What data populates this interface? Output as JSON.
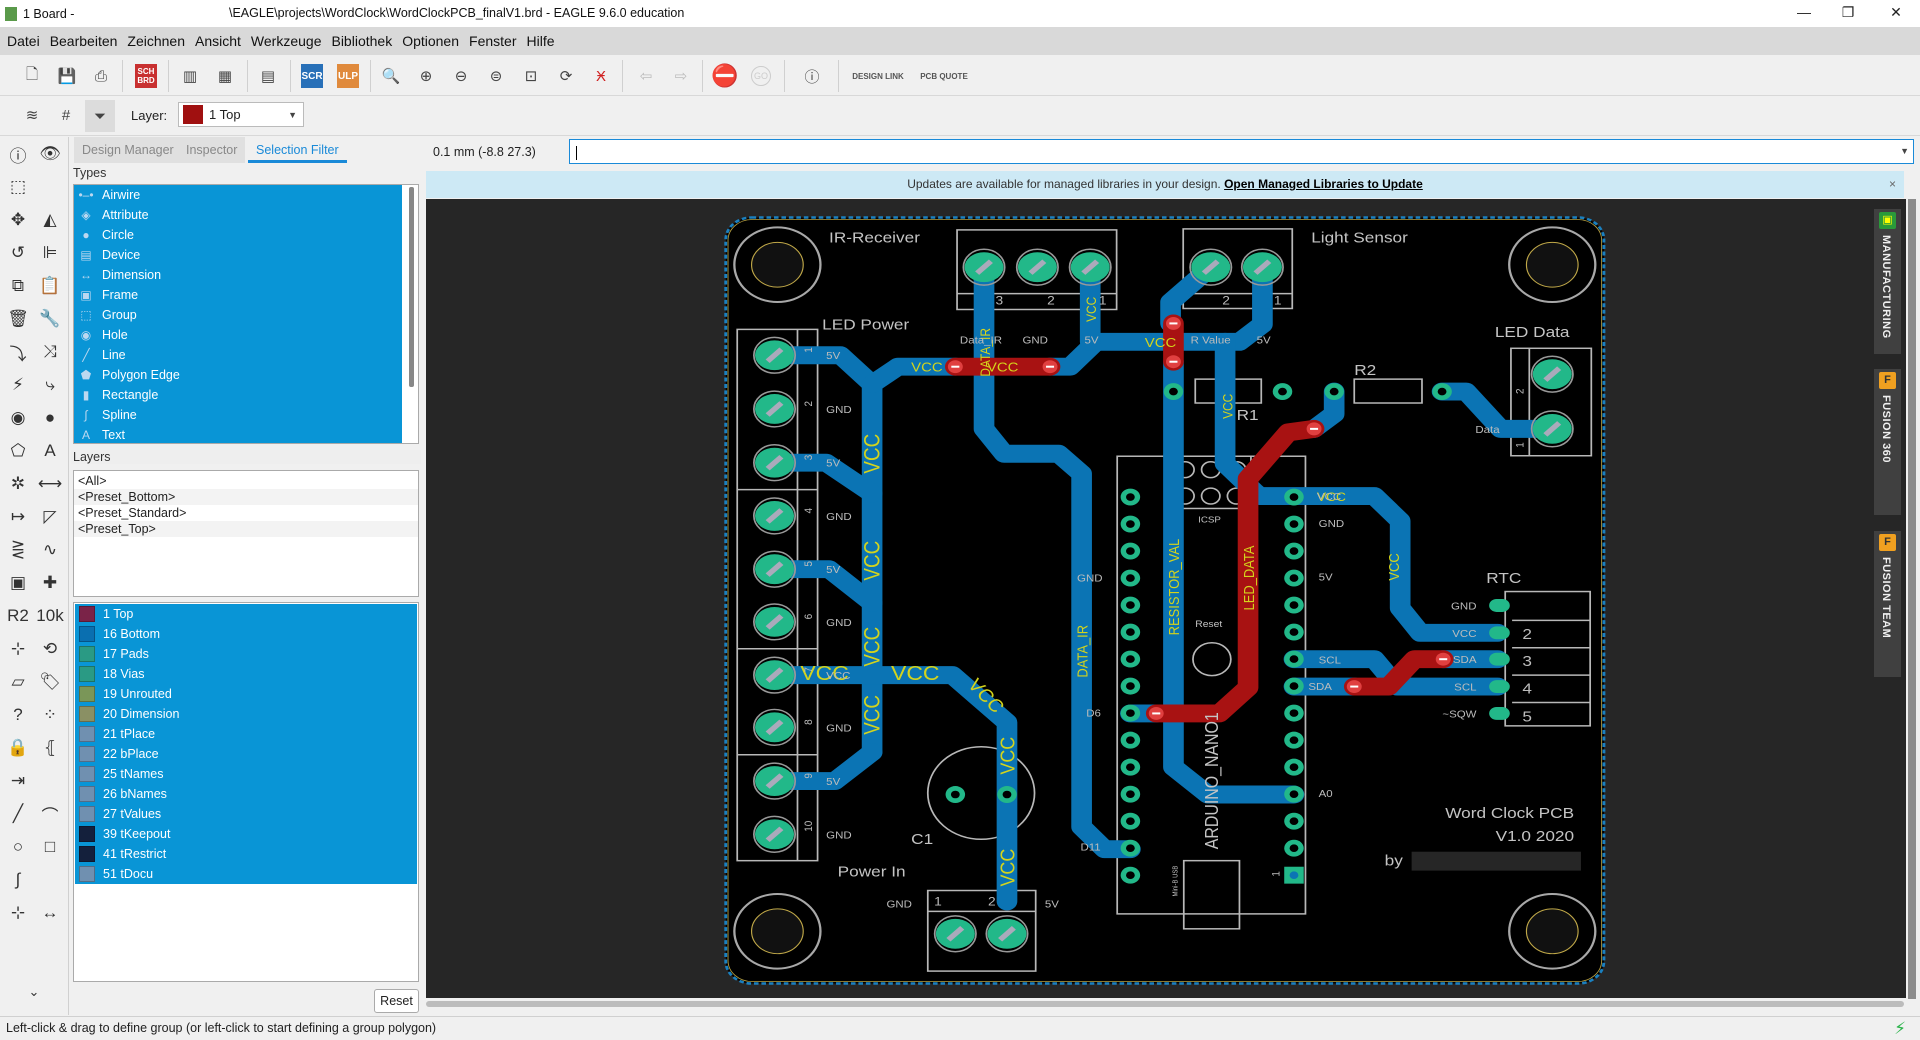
{
  "window": {
    "title_left": "1 Board -",
    "title_path": "\\EAGLE\\projects\\WordClock\\WordClockPCB_finalV1.brd - EAGLE 9.6.0 education",
    "buttons": [
      "minimize",
      "restore",
      "close"
    ]
  },
  "menu": [
    "Datei",
    "Bearbeiten",
    "Zeichnen",
    "Ansicht",
    "Werkzeuge",
    "Bibliothek",
    "Optionen",
    "Fenster",
    "Hilfe"
  ],
  "toolbar": {
    "sch_brd": "SCH BRD",
    "scr": "SCR",
    "ulp": "ULP",
    "go": "GO",
    "design_link": "DESIGN LINK",
    "pcb_quote": "PCB QUOTE"
  },
  "toolbar2": {
    "layer_label": "Layer:",
    "layer_value": "1 Top",
    "layer_color": "#a01010"
  },
  "panel": {
    "tabs": [
      "Design Manager",
      "Inspector",
      "Selection Filter"
    ],
    "active_tab": "Selection Filter",
    "types_header": "Types",
    "types": [
      {
        "label": "Airwire",
        "icon": "airwire-icon"
      },
      {
        "label": "Attribute",
        "icon": "tag-icon"
      },
      {
        "label": "Circle",
        "icon": "circle-icon"
      },
      {
        "label": "Device",
        "icon": "chip-icon"
      },
      {
        "label": "Dimension",
        "icon": "dimension-icon"
      },
      {
        "label": "Frame",
        "icon": "frame-icon"
      },
      {
        "label": "Group",
        "icon": "group-icon"
      },
      {
        "label": "Hole",
        "icon": "hole-icon"
      },
      {
        "label": "Line",
        "icon": "line-icon"
      },
      {
        "label": "Polygon Edge",
        "icon": "polygon-icon"
      },
      {
        "label": "Rectangle",
        "icon": "rectangle-icon"
      },
      {
        "label": "Spline",
        "icon": "spline-icon"
      },
      {
        "label": "Text",
        "icon": "text-icon"
      }
    ],
    "layers_header": "Layers",
    "presets": [
      "<All>",
      "<Preset_Bottom>",
      "<Preset_Standard>",
      "<Preset_Top>"
    ],
    "layers": [
      {
        "label": "1 Top",
        "color": "#7a2348"
      },
      {
        "label": "16 Bottom",
        "color": "#0a6fb0"
      },
      {
        "label": "17 Pads",
        "color": "#2a9a84"
      },
      {
        "label": "18 Vias",
        "color": "#2a9a84"
      },
      {
        "label": "19 Unrouted",
        "color": "#7a9658"
      },
      {
        "label": "20 Dimension",
        "color": "#8a9064"
      },
      {
        "label": "21 tPlace",
        "color": "#7090b0"
      },
      {
        "label": "22 bPlace",
        "color": "#7090b0"
      },
      {
        "label": "25 tNames",
        "color": "#7090b0"
      },
      {
        "label": "26 bNames",
        "color": "#7090b0"
      },
      {
        "label": "27 tValues",
        "color": "#7090b0"
      },
      {
        "label": "39 tKeepout",
        "color": "#14203c"
      },
      {
        "label": "41 tRestrict",
        "color": "#14203c"
      },
      {
        "label": "51 tDocu",
        "color": "#7090b0"
      }
    ],
    "reset_label": "Reset"
  },
  "canvas": {
    "coordinate": "0.1 mm (-8.8 27.3)",
    "command_value": "",
    "notice_text": "Updates are available for managed libraries in your design.",
    "notice_link": "Open Managed Libraries to Update",
    "notice_close": "×"
  },
  "right_tabs": [
    {
      "label": "MANUFACTURING",
      "logo": "chip-logo",
      "color": "#2a9a3a"
    },
    {
      "label": "FUSION 360",
      "logo": "F",
      "color": "#f0a020"
    },
    {
      "label": "FUSION TEAM",
      "logo": "F",
      "color": "#f0a020"
    }
  ],
  "pcb": {
    "names": {
      "ir_receiver": "IR-Receiver",
      "light_sensor": "Light Sensor",
      "led_power": "LED Power",
      "led_data": "LED Data",
      "r1": "R1",
      "r2": "R2",
      "rtc": "RTC",
      "c1": "C1",
      "power_in": "Power In",
      "icsp": "ICSP",
      "reset": "Reset",
      "arduino": "ARDUINO_NANO1",
      "usb": "Mini-B USB",
      "title1": "Word Clock PCB",
      "title2": "V1.0 2020",
      "by": "by"
    },
    "nets": {
      "vcc": "VCC",
      "data_ir_v": "DATA_IR",
      "resistor_val": "RESISTOR_VAL",
      "led_data_v": "LED_DATA"
    },
    "led_power_pins": [
      "1",
      "2",
      "3",
      "4",
      "5",
      "6",
      "7",
      "8",
      "9",
      "10"
    ],
    "led_power_pin_labels": [
      "5V",
      "GND",
      "5V",
      "GND",
      "5V",
      "GND",
      "VCC",
      "GND",
      "5V",
      "GND"
    ],
    "ir_pins": [
      "3",
      "2",
      "1"
    ],
    "ir_pin_labels": [
      "Data_IR",
      "GND",
      "5V"
    ],
    "light_pins": [
      "2",
      "1"
    ],
    "light_pin_labels": [
      "R Value",
      "5V"
    ],
    "led_data_pins": [
      "2",
      "1"
    ],
    "led_data_pin_label": "Data",
    "rtc_pins": [
      "2",
      "3",
      "4",
      "5"
    ],
    "rtc_pin_labels": [
      "GND",
      "VCC",
      "SDA",
      "SCL",
      "~SQW"
    ],
    "nano_labels": [
      "VCC",
      "GND",
      "5V",
      "SCL",
      "SDA",
      "A0",
      "GND",
      "D6",
      "D11",
      "1"
    ],
    "power_pins": [
      "1",
      "2"
    ],
    "power_pin_labels": [
      "GND",
      "5V"
    ],
    "colors": {
      "bottom": "#0b74b4",
      "top": "#a81212",
      "pad": "#22b889",
      "silk": "#b8b8b8",
      "net": "#d4d41c",
      "board": "#000000"
    }
  },
  "status": "Left-click & drag to define group (or left-click to start defining a group polygon)"
}
